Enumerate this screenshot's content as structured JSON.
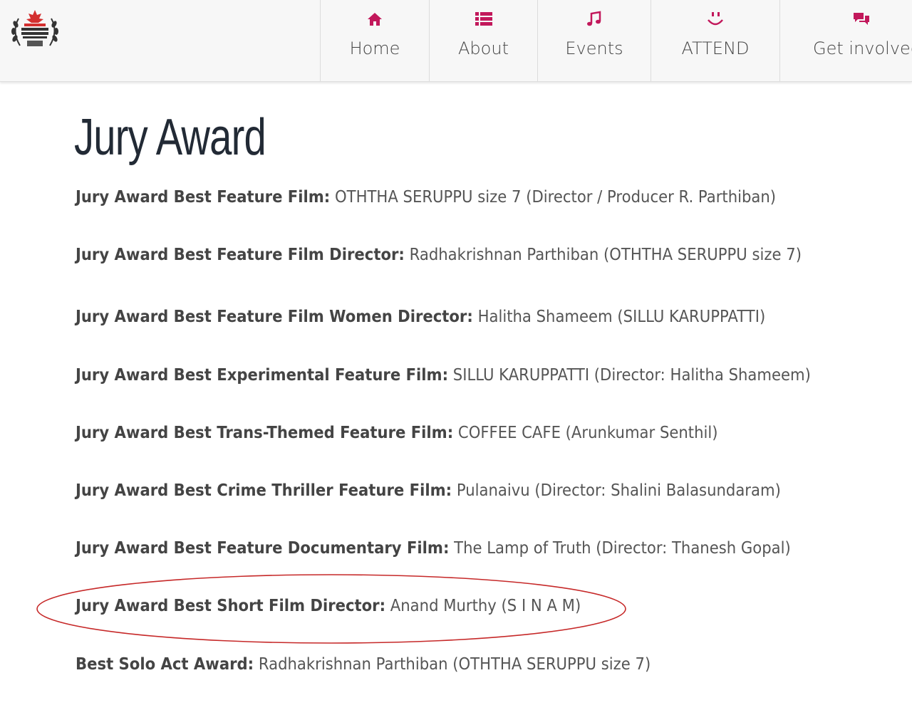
{
  "nav": {
    "items": [
      {
        "label": "Home",
        "icon": "home-icon"
      },
      {
        "label": "About",
        "icon": "list-icon"
      },
      {
        "label": "Events",
        "icon": "music-note-icon"
      },
      {
        "label": "ATTEND",
        "icon": "smile-icon"
      },
      {
        "label": "Get involved",
        "icon": "chat-bubbles-icon"
      }
    ],
    "accent_color": "#c2185b"
  },
  "page": {
    "title": "Jury Award"
  },
  "awards": [
    {
      "category": "Jury Award Best Feature Film:",
      "winner": "OTHTHA SERUPPU size 7 (Director / Producer R. Parthiban)"
    },
    {
      "category": "Jury Award Best Feature Film Director:",
      "winner": "Radhakrishnan Parthiban (OTHTHA SERUPPU size 7)"
    },
    {
      "category": "Jury Award Best Feature Film Women Director:",
      "winner": "Halitha Shameem (SILLU KARUPPATTI)"
    },
    {
      "category": "Jury Award Best Experimental Feature Film:",
      "winner": "SILLU KARUPPATTI (Director: Halitha Shameem)"
    },
    {
      "category": "Jury Award Best Trans-Themed Feature Film:",
      "winner": "COFFEE CAFE (Arunkumar Senthil)"
    },
    {
      "category": "Jury Award Best Crime Thriller Feature Film:",
      "winner": "Pulanaivu (Director: Shalini Balasundaram)"
    },
    {
      "category": "Jury Award Best Feature Documentary Film:",
      "winner": "The Lamp of Truth (Director: Thanesh Gopal)"
    },
    {
      "category": "Jury Award Best Short Film Director:",
      "winner": "Anand Murthy (S I N A M)"
    },
    {
      "category": "Best Solo Act Award:",
      "winner": "Radhakrishnan Parthiban (OTHTHA SERUPPU size 7)"
    }
  ],
  "highlight_color": "#c62828"
}
